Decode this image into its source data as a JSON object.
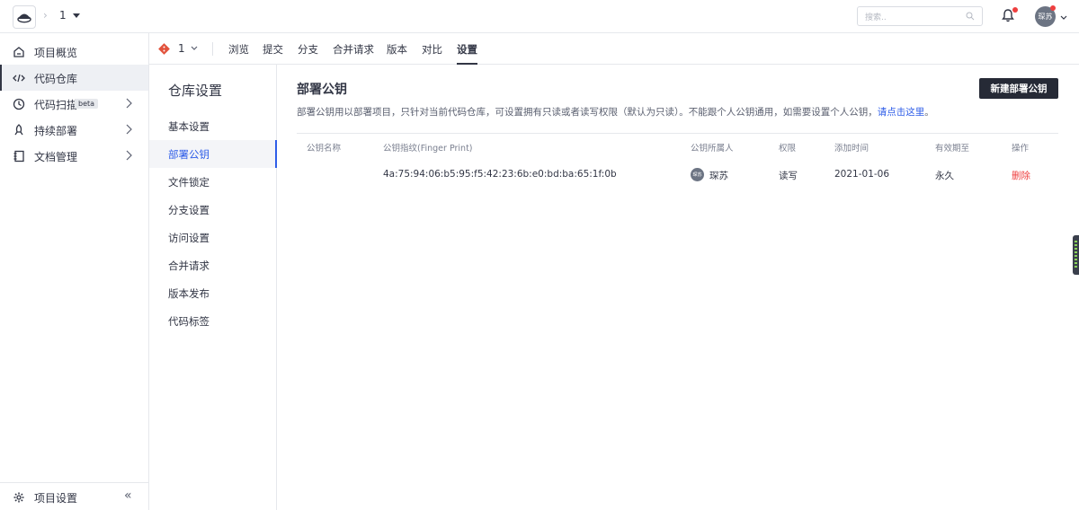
{
  "topbar": {
    "project_name": "1",
    "search_placeholder": "搜索..",
    "avatar_text": "琛苏"
  },
  "sidebar": {
    "items": [
      {
        "label": "项目概览",
        "icon": "home-icon"
      },
      {
        "label": "代码仓库",
        "icon": "code-icon",
        "active": true
      },
      {
        "label": "代码扫描",
        "icon": "scan-icon",
        "badge": "beta"
      },
      {
        "label": "持续部署",
        "icon": "rocket-icon"
      },
      {
        "label": "文档管理",
        "icon": "book-icon"
      }
    ],
    "footer_label": "项目设置",
    "collapse_glyph": "«"
  },
  "subtabs": {
    "branch_label": "1",
    "tabs": [
      "浏览",
      "提交",
      "分支",
      "合并请求",
      "版本",
      "对比",
      "设置"
    ],
    "active": "设置"
  },
  "settings_menu": {
    "title": "仓库设置",
    "items": [
      "基本设置",
      "部署公钥",
      "文件锁定",
      "分支设置",
      "访问设置",
      "合并请求",
      "版本发布",
      "代码标签"
    ],
    "active": "部署公钥"
  },
  "main": {
    "title": "部署公钥",
    "new_button": "新建部署公钥",
    "description": "部署公钥用以部署项目，只针对当前代码仓库，可设置拥有只读或者读写权限（默认为只读）。不能跟个人公钥通用，如需要设置个人公钥，",
    "description_link": "请点击这里",
    "description_end": "。",
    "columns": [
      "公钥名称",
      "公钥指纹(Finger Print)",
      "公钥所属人",
      "权限",
      "添加时间",
      "有效期至",
      "操作"
    ],
    "rows": [
      {
        "name": "",
        "fingerprint": "4a:75:94:06:b5:95:f5:42:23:6b:e0:bd:ba:65:1f:0b",
        "owner_avatar": "琛苏",
        "owner": "琛苏",
        "permission": "读写",
        "added": "2021-01-06",
        "expires": "永久",
        "action": "删除"
      }
    ]
  },
  "colors": {
    "accent": "#2f5ee8",
    "dark": "#262a36",
    "danger": "#ee3f3f"
  }
}
